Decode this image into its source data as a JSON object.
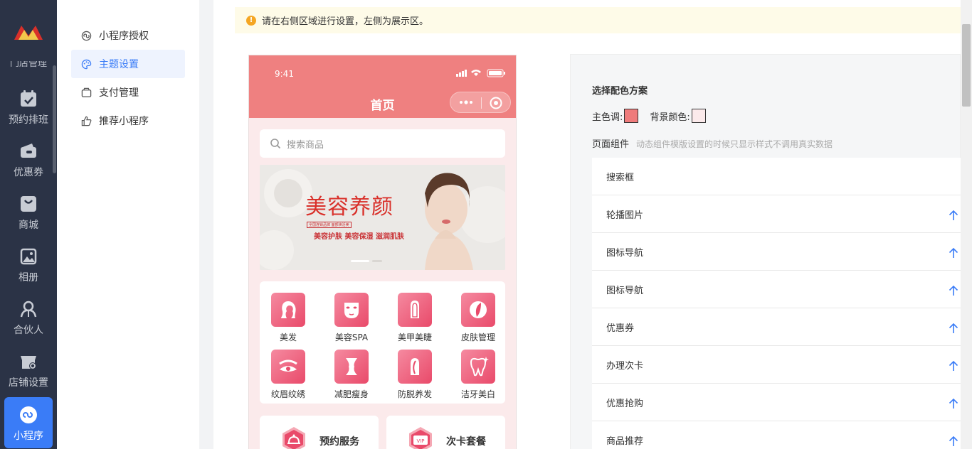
{
  "rail": {
    "cut_label": "门店管理",
    "items": [
      {
        "label": "预约排班",
        "icon": "calendar-check-icon"
      },
      {
        "label": "优惠券",
        "icon": "wallet-icon"
      },
      {
        "label": "商城",
        "icon": "shopping-bag-icon"
      },
      {
        "label": "相册",
        "icon": "photo-album-icon"
      },
      {
        "label": "合伙人",
        "icon": "partner-icon"
      },
      {
        "label": "店铺设置",
        "icon": "store-settings-icon"
      },
      {
        "label": "小程序",
        "icon": "mini-program-icon"
      }
    ]
  },
  "submenu": {
    "items": [
      {
        "label": "小程序授权",
        "icon": "authorize-icon"
      },
      {
        "label": "主题设置",
        "icon": "palette-icon"
      },
      {
        "label": "支付管理",
        "icon": "payment-icon"
      },
      {
        "label": "推荐小程序",
        "icon": "thumbs-up-icon"
      }
    ]
  },
  "notice": {
    "text": "请在右侧区域进行设置，左侧为展示区。"
  },
  "phone": {
    "time": "9:41",
    "nav_title": "首页",
    "search_placeholder": "搜索商品",
    "banner_title": "美容养颜",
    "banner_small": "全国连锁品牌 面部焕活美",
    "banner_sub": "美容护肤 美容保湿 滋润肌肤",
    "nav_items": [
      "美发",
      "美容SPA",
      "美甲美睫",
      "皮肤管理",
      "纹眉纹绣",
      "减肥瘦身",
      "防脱养发",
      "洁牙美白"
    ],
    "services": [
      "预约服务",
      "次卡套餐"
    ],
    "theme_color": "#ef8080"
  },
  "panel": {
    "title": "选择配色方案",
    "main_color_label": "主色调:",
    "main_color": "#ef7b7b",
    "bg_color_label": "背景颜色:",
    "bg_color": "#fbeaeb",
    "components_label": "页面组件",
    "components_hint": "动态组件模版设置的时候只显示样式不调用真实数据",
    "components": [
      "搜索框",
      "轮播图片",
      "图标导航",
      "图标导航",
      "优惠券",
      "办理次卡",
      "优惠抢购",
      "商品推荐"
    ]
  }
}
